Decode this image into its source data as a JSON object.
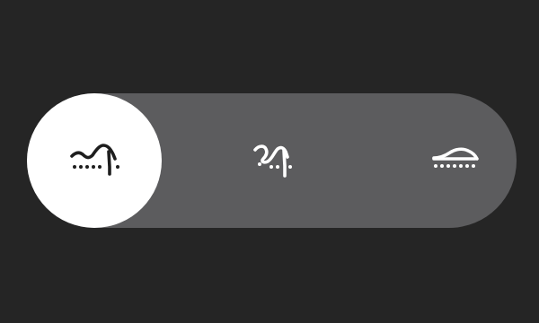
{
  "segmented_control": {
    "selected_index": 0,
    "options": [
      {
        "icon": "wave-peak-dots-icon",
        "selected": true
      },
      {
        "icon": "loop-wave-dots-icon",
        "selected": false
      },
      {
        "icon": "flat-wave-dots-icon",
        "selected": false
      }
    ],
    "colors": {
      "background": "#252525",
      "track": "#5c5c5e",
      "selected_fill": "#ffffff",
      "selected_icon": "#1e1e1e",
      "icon": "#ffffff"
    }
  }
}
